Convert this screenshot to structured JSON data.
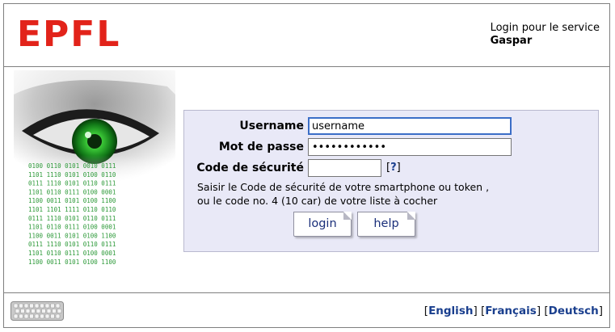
{
  "logo": {
    "text": "EPFL",
    "color": "#e2231a"
  },
  "service": {
    "line1": "Login pour le service",
    "line2": "Gaspar"
  },
  "form": {
    "username_label": "Username",
    "username_value": "username",
    "password_label": "Mot de passe",
    "password_value": "••••••••••••",
    "code_label": "Code de sécurité",
    "code_value": "",
    "code_help": "?",
    "info_line1": "Saisir le Code de sécurité de votre smartphone ou token ,",
    "info_line2": "ou le code no. 4 (10 car) de votre liste à cocher",
    "login_button": "login",
    "help_button": "help"
  },
  "binary_rows": [
    "0100 0110 0101 0010 0111",
    "1101 1110 0101 0100 0110",
    "0111 1110 0101 0110 0111",
    "1101 0110 0111 0100 0001",
    "1100 0011 0101 0100 1100",
    "1101 1101 1111 0110 0110",
    "0111 1110 0101 0110 0111",
    "1101 0110 0111 0100 0001",
    "1100 0011 0101 0100 1100",
    "0111 1110 0101 0110 0111",
    "1101 0110 0111 0100 0001",
    "1100 0011 0101 0100 1100"
  ],
  "footer": {
    "lang_english": "English",
    "lang_francais": "Français",
    "lang_deutsch": "Deutsch",
    "keyboard_icon": "keyboard-icon"
  },
  "colors": {
    "accent": "#1a3f8e",
    "panel": "#e9e9f7",
    "focus": "#3b6ec7",
    "binary": "#2e9a3a"
  }
}
